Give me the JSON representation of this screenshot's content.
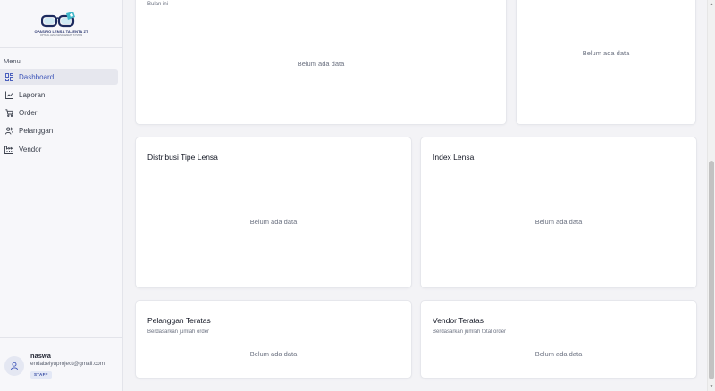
{
  "brand": {
    "title": "OPASIRO LENSA TALENTA ZT",
    "subtitle": "OPTICAL LENS MANAGEMENT SYSTEM"
  },
  "sidebar": {
    "menu_label": "Menu",
    "items": [
      {
        "label": "Dashboard",
        "icon": "dashboard-grid-icon",
        "active": true
      },
      {
        "label": "Laporan",
        "icon": "chart-line-icon",
        "active": false
      },
      {
        "label": "Order",
        "icon": "cart-icon",
        "active": false
      },
      {
        "label": "Pelanggan",
        "icon": "users-icon",
        "active": false
      },
      {
        "label": "Vendor",
        "icon": "factory-icon",
        "active": false
      }
    ],
    "user": {
      "name": "naswa",
      "email": "endabelyuproject@gmail.com",
      "role": "STAFF"
    }
  },
  "cards": {
    "top_left": {
      "subtitle": "Bulan ini",
      "empty": "Belum ada data"
    },
    "top_right": {
      "empty": "Belum ada data"
    },
    "distribusi": {
      "title": "Distribusi Tipe Lensa",
      "empty": "Belum ada data"
    },
    "index": {
      "title": "Index Lensa",
      "empty": "Belum ada data"
    },
    "pelanggan": {
      "title": "Pelanggan Teratas",
      "subtitle": "Berdasarkan jumlah order",
      "empty": "Belum ada data"
    },
    "vendor": {
      "title": "Vendor Teratas",
      "subtitle": "Berdasarkan jumlah total order",
      "empty": "Belum ada data"
    }
  },
  "colors": {
    "accent": "#3b53b8",
    "sidebar_bg": "#f7f7fa",
    "page_bg": "#f3f3f6",
    "active_bg": "#e6e7ee"
  }
}
